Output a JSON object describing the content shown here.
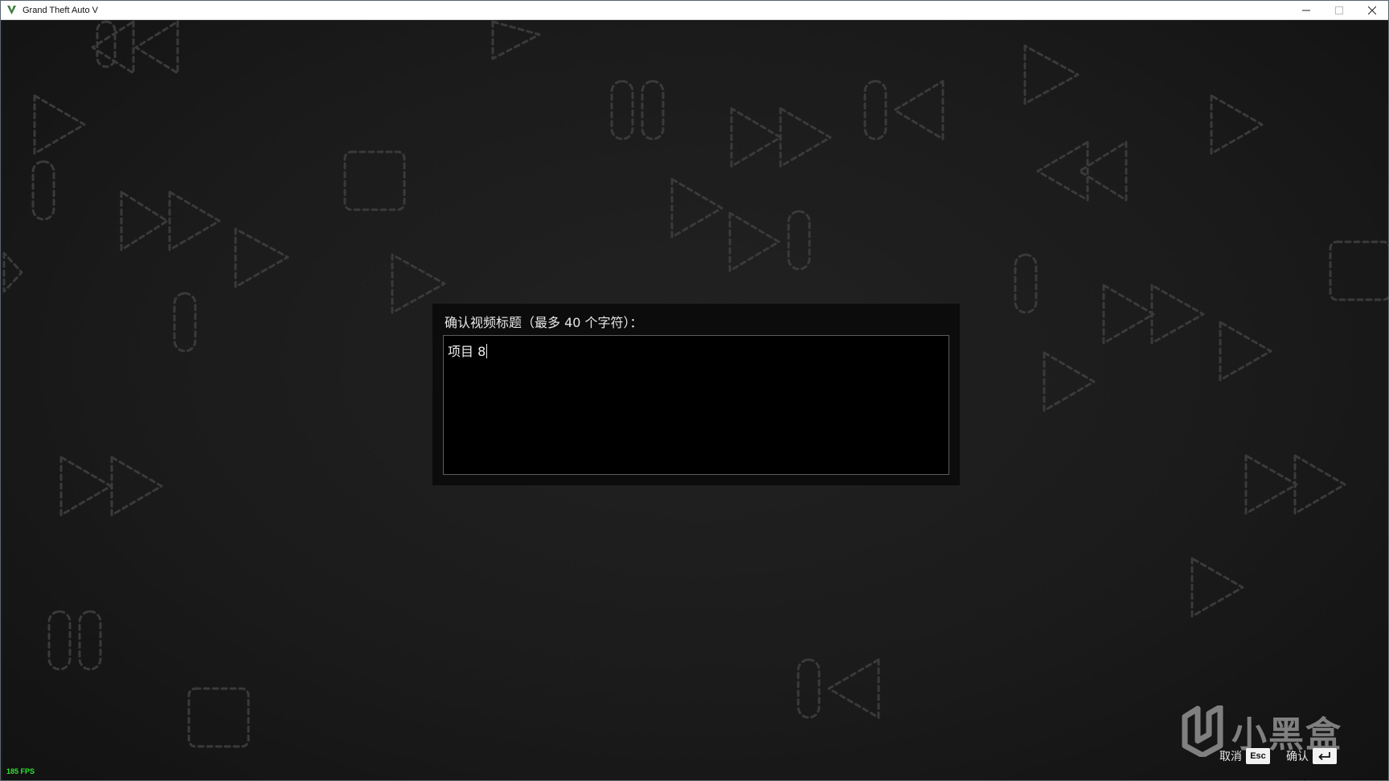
{
  "window": {
    "title": "Grand Theft Auto V",
    "controls": [
      "minimize-icon",
      "maximize-icon",
      "close-icon"
    ]
  },
  "dialog": {
    "prompt": "确认视频标题（最多 40 个字符）：",
    "input_value": "项目 8"
  },
  "hints": {
    "cancel_label": "取消",
    "cancel_key": "Esc",
    "confirm_label": "确认",
    "confirm_key_icon": "enter-key-icon"
  },
  "overlay": {
    "fps": "185 FPS",
    "watermark_text": "小黑盒"
  },
  "colors": {
    "fps": "#2ee62e",
    "background": "#1a1a1a",
    "dialog": "#0c0c0c"
  }
}
